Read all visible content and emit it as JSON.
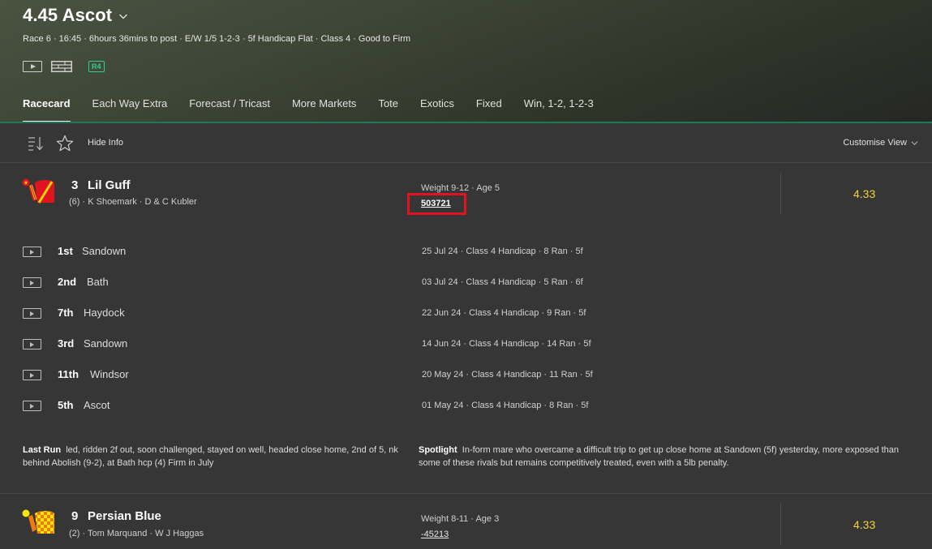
{
  "header": {
    "title": "4.45 Ascot",
    "race_info": "Race 6 · 16:45 · 6hours 36mins to post · E/W 1/5 1-2-3 · 5f Handicap Flat · Class 4 · Good to Firm",
    "badge": "R4",
    "icons": [
      "play-video-icon",
      "racecard-icon",
      "r4-badge"
    ]
  },
  "tabs": [
    {
      "label": "Racecard",
      "active": true
    },
    {
      "label": "Each Way Extra"
    },
    {
      "label": "Forecast / Tricast"
    },
    {
      "label": "More Markets"
    },
    {
      "label": "Tote"
    },
    {
      "label": "Exotics"
    },
    {
      "label": "Fixed"
    },
    {
      "label": "Win, 1-2, 1-2-3"
    }
  ],
  "toolbar": {
    "hide_info": "Hide Info",
    "customise_view": "Customise View"
  },
  "colors": {
    "accent_green": "#1e7a55",
    "odds_yellow": "#f0d43a",
    "highlight_red": "#e0141e",
    "badge_green": "#2fd08a"
  },
  "runners": [
    {
      "number": "3",
      "name": "Lil Guff",
      "draw": "(6)",
      "jockey": "K Shoemark",
      "trainer": "D & C Kubler",
      "sub": "(6) · K Shoemark · D & C Kubler",
      "weight_age": "Weight 9-12 · Age 5",
      "form": "503721",
      "odds": "4.33",
      "silk_colors": [
        "#e0141e",
        "#f5d20a"
      ],
      "form_runs": [
        {
          "pos": "1st",
          "course": "Sandown",
          "details": "25 Jul 24 · Class 4 Handicap · 8 Ran · 5f"
        },
        {
          "pos": "2nd",
          "course": "Bath",
          "details": "03 Jul 24 · Class 4 Handicap · 5 Ran · 6f"
        },
        {
          "pos": "7th",
          "course": "Haydock",
          "details": "22 Jun 24 · Class 4 Handicap · 9 Ran · 5f"
        },
        {
          "pos": "3rd",
          "course": "Sandown",
          "details": "14 Jun 24 · Class 4 Handicap · 14 Ran · 5f"
        },
        {
          "pos": "11th",
          "course": "Windsor",
          "details": "20 May 24 · Class 4 Handicap · 11 Ran · 5f"
        },
        {
          "pos": "5th",
          "course": "Ascot",
          "details": "01 May 24 · Class 4 Handicap · 8 Ran · 5f"
        }
      ],
      "last_run_label": "Last Run",
      "last_run": "led, ridden 2f out, soon challenged, stayed on well, headed close home, 2nd of 5, nk behind Abolish (9-2), at Bath hcp (4) Firm in July",
      "spotlight_label": "Spotlight",
      "spotlight": "In-form mare who overcame a difficult trip to get up close home at Sandown (5f) yesterday, more exposed than some of these rivals but remains competitively treated, even with a 5lb penalty."
    },
    {
      "number": "9",
      "name": "Persian Blue",
      "draw": "(2)",
      "jockey": "Tom Marquand",
      "trainer": "W J Haggas",
      "sub": "(2) · Tom Marquand · W J Haggas",
      "weight_age": "Weight 8-11 · Age 3",
      "form": "-45213",
      "odds": "4.33",
      "silk_colors": [
        "#f07a10",
        "#f5e60a"
      ]
    }
  ]
}
